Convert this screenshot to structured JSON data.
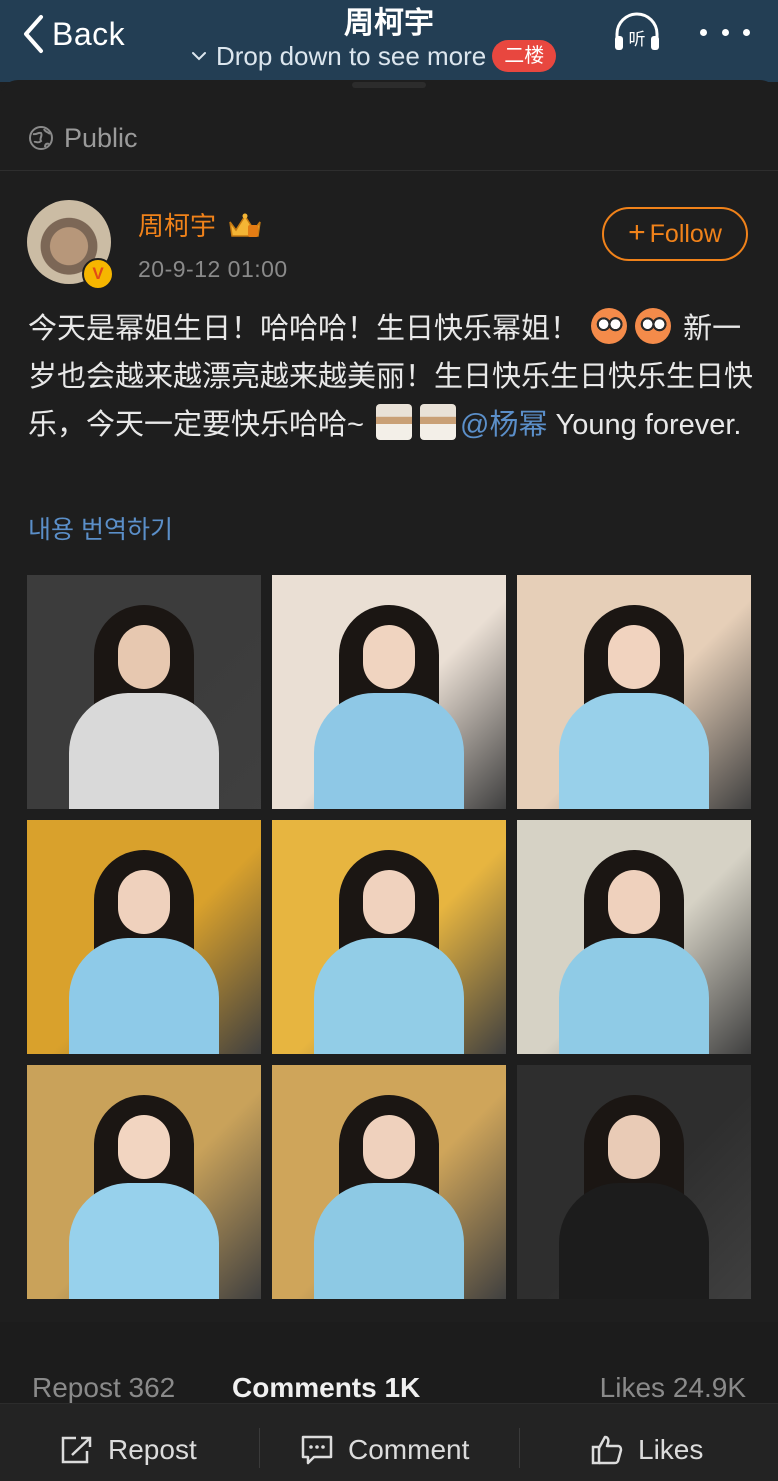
{
  "header": {
    "back_label": "Back",
    "title": "周柯宇",
    "subtitle": "Drop down to see more",
    "floor_badge": "二楼",
    "listen_label": "听"
  },
  "visibility": "Public",
  "author": {
    "name": "周柯宇",
    "verified_mark": "V",
    "date": "20-9-12 01:00",
    "follow_label": "Follow"
  },
  "post": {
    "text_part1": "今天是幂姐生日！哈哈哈！生日快乐幂姐！",
    "text_part2": "新一岁也会越来越漂亮越来越美丽！生日快乐生日快乐生日快乐，今天一定要快乐哈哈~",
    "mention": "@杨幂",
    "text_part3": " Young forever.",
    "translate_label": "내용 번역하기"
  },
  "photos": [
    {
      "bg": "#3c3c3c",
      "top": "#d9d9d9",
      "skin": "#e7c8b0"
    },
    {
      "bg": "#eadfd4",
      "top": "#8ec8e6",
      "skin": "#f0d4c0"
    },
    {
      "bg": "#e6cfb8",
      "top": "#98d0ea",
      "skin": "#f1d3bf"
    },
    {
      "bg": "#d9a12c",
      "top": "#8ecae8",
      "skin": "#efd1bd"
    },
    {
      "bg": "#e7b540",
      "top": "#92cde7",
      "skin": "#f0d2be"
    },
    {
      "bg": "#d6d2c5",
      "top": "#8fcbe6",
      "skin": "#efd1bd"
    },
    {
      "bg": "#c9a25a",
      "top": "#97d1ec",
      "skin": "#f2d5c1"
    },
    {
      "bg": "#cfa55a",
      "top": "#8dc9e4",
      "skin": "#efd1bd"
    },
    {
      "bg": "#2e2e2e",
      "top": "#1c1c1c",
      "skin": "#e9cbb6"
    }
  ],
  "stats": {
    "repost": "Repost 362",
    "comments": "Comments 1K",
    "likes": "Likes 24.9K"
  },
  "actions": {
    "repost": "Repost",
    "comment": "Comment",
    "likes": "Likes"
  },
  "colors": {
    "header_bg": "#233e54",
    "accent": "#f0821a",
    "link": "#5b8fc9",
    "badge": "#e8473f"
  }
}
